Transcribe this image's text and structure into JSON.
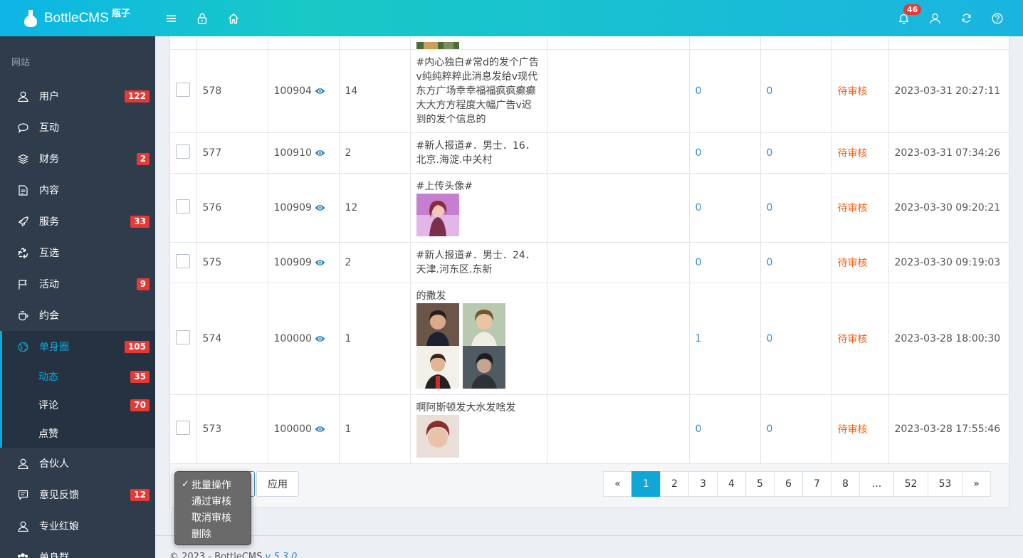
{
  "header": {
    "brand": "BottleCMS",
    "brand_sub": "瓶子",
    "notification_count": "46"
  },
  "sidebar": {
    "section": "网站",
    "items": [
      {
        "label": "用户",
        "badge": "122",
        "icon": "user-icon"
      },
      {
        "label": "互动",
        "badge": "",
        "icon": "chat-icon"
      },
      {
        "label": "财务",
        "badge": "2",
        "icon": "layers-icon"
      },
      {
        "label": "内容",
        "badge": "",
        "icon": "document-icon"
      },
      {
        "label": "服务",
        "badge": "33",
        "icon": "rocket-icon"
      },
      {
        "label": "互选",
        "badge": "",
        "icon": "recycle-icon"
      },
      {
        "label": "活动",
        "badge": "9",
        "icon": "flag-icon"
      },
      {
        "label": "约会",
        "badge": "",
        "icon": "cup-icon"
      },
      {
        "label": "单身圈",
        "badge": "105",
        "icon": "globe-icon"
      }
    ],
    "sub_items": [
      {
        "label": "动态",
        "badge": "35"
      },
      {
        "label": "评论",
        "badge": "70"
      },
      {
        "label": "点赞",
        "badge": ""
      }
    ],
    "items_after": [
      {
        "label": "合伙人",
        "badge": "",
        "icon": "user-icon"
      },
      {
        "label": "意见反馈",
        "badge": "12",
        "icon": "message-icon"
      },
      {
        "label": "专业红娘",
        "badge": "",
        "icon": "user-icon"
      },
      {
        "label": "单身群",
        "badge": "",
        "icon": "group-icon"
      }
    ]
  },
  "rows": [
    {
      "id": "578",
      "user": "100904",
      "count": "14",
      "text": "#内心独白#常d的发个广告v纯纯粹粹此消息发给v现代东方广场幸幸福福疯疯癫癫大大方方程度大幅广告v迟到的发个信息的",
      "col_a": "0",
      "col_b": "0",
      "status": "待审核",
      "time": "2023-03-31 20:27:11"
    },
    {
      "id": "577",
      "user": "100910",
      "count": "2",
      "text": "#新人报道#．男士．16．北京.海淀.中关村",
      "col_a": "0",
      "col_b": "0",
      "status": "待审核",
      "time": "2023-03-31 07:34:26"
    },
    {
      "id": "576",
      "user": "100909",
      "count": "12",
      "text": "#上传头像#",
      "col_a": "0",
      "col_b": "0",
      "status": "待审核",
      "time": "2023-03-30 09:20:21"
    },
    {
      "id": "575",
      "user": "100909",
      "count": "2",
      "text": "#新人报道#．男士．24．天津.河东区.东新",
      "col_a": "0",
      "col_b": "0",
      "status": "待审核",
      "time": "2023-03-30 09:19:03"
    },
    {
      "id": "574",
      "user": "100000",
      "count": "1",
      "text": "的撒发",
      "col_a": "1",
      "col_b": "0",
      "status": "待审核",
      "time": "2023-03-28 18:00:30"
    },
    {
      "id": "573",
      "user": "100000",
      "count": "1",
      "text": "啊阿斯顿发大水发啥发",
      "col_a": "0",
      "col_b": "0",
      "status": "待审核",
      "time": "2023-03-28 17:55:46"
    }
  ],
  "bulk": {
    "options": [
      "批量操作",
      "通过审核",
      "取消审核",
      "删除"
    ],
    "selected": "批量操作",
    "apply_label": "应用"
  },
  "pager": {
    "prev": "«",
    "pages": [
      "1",
      "2",
      "3",
      "4",
      "5",
      "6",
      "7",
      "8",
      "...",
      "52",
      "53"
    ],
    "next": "»",
    "current": "1"
  },
  "footer": {
    "text": "© 2023 - BottleCMS",
    "version": "v 5.3.0"
  },
  "colors": {
    "accent": "#10a7d6",
    "badge": "#e53935",
    "pending": "#f0651b",
    "link": "#3c8dbc",
    "sidebar": "#2f3c4c"
  }
}
